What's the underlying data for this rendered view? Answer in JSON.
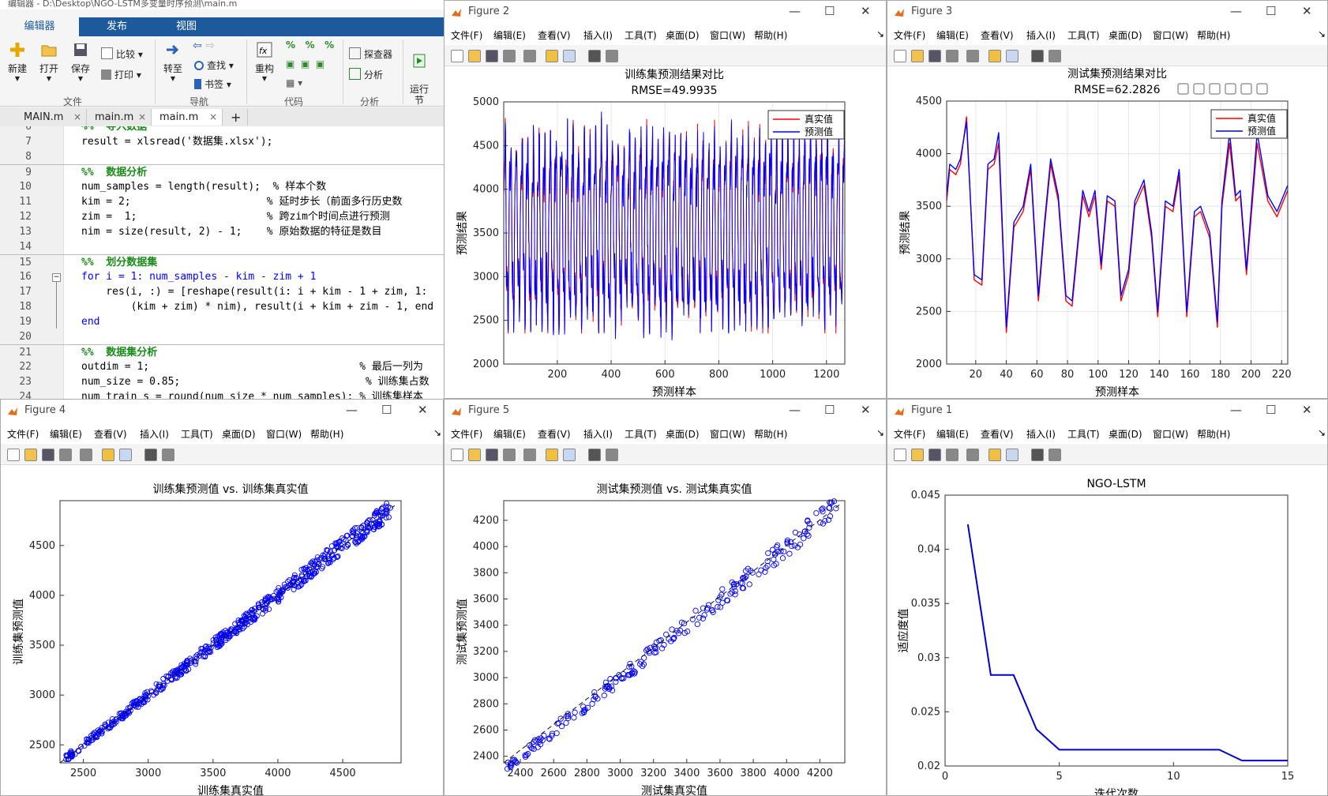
{
  "editor": {
    "title": "编辑器 - D:\\Desktop\\NGO-LSTM多变量时序预测\\main.m",
    "ribbon_tabs": [
      "编辑器",
      "发布",
      "视图"
    ],
    "buttons": {
      "new": "新建",
      "open": "打开",
      "save": "保存",
      "compare": "比较",
      "print": "打印",
      "goto": "转至",
      "find": "查找",
      "bookmark": "书签",
      "refactor": "重构",
      "explorer": "探查器",
      "analyze": "分析",
      "run_section": "运行\n节"
    },
    "sections": {
      "file": "文件",
      "navigate": "导航",
      "code": "代码",
      "analyze": "分析"
    },
    "file_tabs": [
      "MAIN.m",
      "main.m",
      "main.m"
    ],
    "code_lines": [
      {
        "n": "6",
        "t": "%%  导入数据"
      },
      {
        "n": "7",
        "t": "result = xlsread('数据集.xlsx');"
      },
      {
        "n": "8",
        "t": ""
      },
      {
        "n": "9",
        "t": "%%  数据分析"
      },
      {
        "n": "10",
        "t": "num_samples = length(result);  % 样本个数"
      },
      {
        "n": "11",
        "t": "kim = 2;                      % 延时步长（前面多行历史数"
      },
      {
        "n": "12",
        "t": "zim =  1;                     % 跨zim个时间点进行预测"
      },
      {
        "n": "13",
        "t": "nim = size(result, 2) - 1;    % 原始数据的特征是数目"
      },
      {
        "n": "14",
        "t": ""
      },
      {
        "n": "15",
        "t": "%%  划分数据集"
      },
      {
        "n": "16",
        "t": "for i = 1: num_samples - kim - zim + 1"
      },
      {
        "n": "17",
        "t": "    res(i, :) = [reshape(result(i: i + kim - 1 + zim, 1:"
      },
      {
        "n": "18",
        "t": "        (kim + zim) * nim), result(i + kim + zim - 1, end"
      },
      {
        "n": "19",
        "t": "end"
      },
      {
        "n": "20",
        "t": ""
      },
      {
        "n": "21",
        "t": "%%  数据集分析"
      },
      {
        "n": "22",
        "t": "outdim = 1;                                  % 最后一列为"
      },
      {
        "n": "23",
        "t": "num_size = 0.85;                              % 训练集占数"
      },
      {
        "n": "24",
        "t": "num_train_s = round(num_size * num_samples); % 训练集样本"
      }
    ]
  },
  "menu_items": [
    "文件(F)",
    "编辑(E)",
    "查看(V)",
    "插入(I)",
    "工具(T)",
    "桌面(D)",
    "窗口(W)",
    "帮助(H)"
  ],
  "figures": {
    "fig2": {
      "title": "Figure 2"
    },
    "fig3": {
      "title": "Figure 3"
    },
    "fig4": {
      "title": "Figure 4"
    },
    "fig5": {
      "title": "Figure 5"
    },
    "fig1": {
      "title": "Figure 1"
    }
  },
  "chart_data": [
    {
      "id": "fig2",
      "type": "line",
      "title": "训练集预测结果对比",
      "subtitle": "RMSE=49.9935",
      "xlabel": "预测样本",
      "ylabel": "预测结果",
      "xlim": [
        1,
        1268
      ],
      "ylim": [
        2000,
        5000
      ],
      "xticks": [
        200,
        400,
        600,
        800,
        1000,
        1200
      ],
      "yticks": [
        2000,
        2500,
        3000,
        3500,
        4000,
        4500,
        5000
      ],
      "legend": [
        "真实值",
        "预测值"
      ],
      "legend_position": "top-right",
      "grid": true,
      "series": [
        {
          "name": "真实值",
          "color": "#ff0000",
          "period": 21,
          "points": 1268,
          "min": 2350,
          "max": 4900
        },
        {
          "name": "预测值",
          "color": "#0000ff",
          "period": 21,
          "points": 1268,
          "min": 2350,
          "max": 4950
        }
      ]
    },
    {
      "id": "fig3",
      "type": "line",
      "title": "测试集预测结果对比",
      "subtitle": "RMSE=62.2826",
      "xlabel": "预测样本",
      "ylabel": "预测结果",
      "xlim": [
        1,
        224
      ],
      "ylim": [
        2000,
        4500
      ],
      "xticks": [
        20,
        40,
        60,
        80,
        100,
        120,
        140,
        160,
        180,
        200,
        220
      ],
      "yticks": [
        2000,
        2500,
        3000,
        3500,
        4000,
        4500
      ],
      "legend": [
        "真实值",
        "预测值"
      ],
      "legend_position": "top-right",
      "grid": true,
      "x": [
        1,
        3,
        7,
        10,
        14,
        19,
        24,
        28,
        32,
        35,
        40,
        45,
        51,
        56,
        61,
        65,
        69,
        74,
        79,
        83,
        90,
        94,
        98,
        102,
        106,
        111,
        115,
        120,
        124,
        130,
        135,
        139,
        144,
        149,
        153,
        158,
        163,
        167,
        173,
        178,
        181,
        186,
        190,
        193,
        197,
        204,
        211,
        217,
        224
      ],
      "series": [
        {
          "name": "真实值",
          "color": "#ff0000",
          "values": [
            3550,
            3850,
            3800,
            3900,
            4350,
            2800,
            2750,
            3850,
            3900,
            4100,
            2300,
            3300,
            3450,
            3850,
            2600,
            3300,
            3900,
            3550,
            2600,
            2550,
            3600,
            3400,
            3600,
            2900,
            3550,
            3500,
            2600,
            2850,
            3500,
            3700,
            3200,
            2450,
            3500,
            3450,
            3800,
            2450,
            3400,
            3450,
            3200,
            2350,
            3500,
            4100,
            3550,
            3600,
            2850,
            4100,
            3550,
            3400,
            3650
          ]
        },
        {
          "name": "预测值",
          "color": "#0000ff",
          "values": [
            3600,
            3900,
            3850,
            3950,
            4300,
            2850,
            2800,
            3900,
            3950,
            4200,
            2350,
            3350,
            3500,
            3900,
            2650,
            3350,
            3950,
            3600,
            2650,
            2600,
            3650,
            3450,
            3650,
            2950,
            3600,
            3550,
            2650,
            2900,
            3550,
            3750,
            3250,
            2500,
            3550,
            3500,
            3850,
            2500,
            3450,
            3500,
            3250,
            2400,
            3550,
            4200,
            3600,
            3650,
            2900,
            4200,
            3600,
            3450,
            3700
          ]
        }
      ]
    },
    {
      "id": "fig4",
      "type": "scatter",
      "title": "训练集预测值 vs. 训练集真实值",
      "xlabel": "训练集真实值",
      "ylabel": "训练集预测值",
      "xlim": [
        2320,
        4950
      ],
      "ylim": [
        2320,
        4950
      ],
      "xticks": [
        2500,
        3000,
        3500,
        4000,
        4500
      ],
      "yticks": [
        2500,
        3000,
        3500,
        4000,
        4500
      ],
      "points": 1268,
      "marker_color": "#0000ff",
      "reference_line": "y = x"
    },
    {
      "id": "fig5",
      "type": "scatter",
      "title": "测试集预测值 vs. 测试集真实值",
      "xlabel": "测试集真实值",
      "ylabel": "测试集预测值",
      "xlim": [
        2300,
        4350
      ],
      "ylim": [
        2350,
        4350
      ],
      "xticks": [
        2400,
        2600,
        2800,
        3000,
        3200,
        3400,
        3600,
        3800,
        4000,
        4200
      ],
      "yticks": [
        2400,
        2600,
        2800,
        3000,
        3200,
        3400,
        3600,
        3800,
        4000,
        4200
      ],
      "points": 224,
      "marker_color": "#0000ff",
      "reference_line": "y = x"
    },
    {
      "id": "fig1",
      "type": "line",
      "title": "NGO-LSTM",
      "xlabel": "迭代次数",
      "ylabel": "适应度值",
      "xlim": [
        0,
        15
      ],
      "ylim": [
        0.02,
        0.045
      ],
      "xticks": [
        0,
        5,
        10,
        15
      ],
      "yticks": [
        0.02,
        0.025,
        0.03,
        0.035,
        0.04,
        0.045
      ],
      "series": [
        {
          "name": "",
          "color": "#0000cc",
          "x": [
            1,
            2,
            3,
            4,
            5,
            6,
            7,
            8,
            9,
            10,
            11,
            12,
            13,
            14,
            15
          ],
          "values": [
            0.0423,
            0.0284,
            0.0284,
            0.0234,
            0.0215,
            0.0215,
            0.0215,
            0.0215,
            0.0215,
            0.0215,
            0.0215,
            0.0215,
            0.0205,
            0.0205,
            0.0205
          ]
        }
      ]
    }
  ]
}
